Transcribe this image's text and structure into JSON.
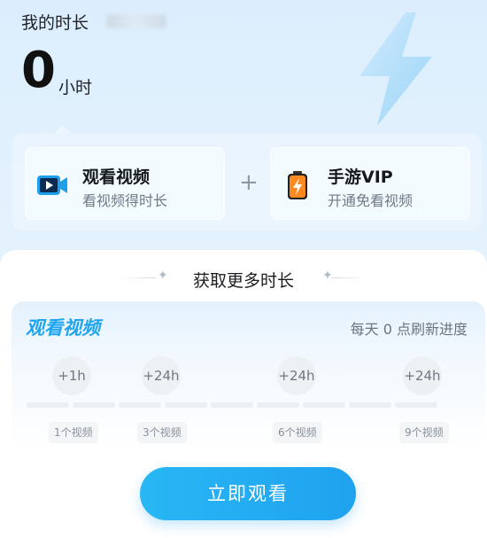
{
  "header": {
    "title": "我的时长",
    "hours_value": "0",
    "hours_unit": "小时"
  },
  "cards": [
    {
      "title": "观看视频",
      "subtitle": "看视频得时长",
      "icon": "video-camera-icon"
    },
    {
      "title": "手游VIP",
      "subtitle": "开通免看视频",
      "icon": "battery-bolt-icon"
    }
  ],
  "plus_symbol": "+",
  "more": {
    "title": "获取更多时长"
  },
  "task": {
    "title": "观看视频",
    "refresh_note": "每天 0 点刷新进度",
    "milestones": [
      {
        "reward": "+1h",
        "videos": "1个视频"
      },
      {
        "reward": "+24h",
        "videos": "3个视频"
      },
      {
        "reward": "+24h",
        "videos": "6个视频"
      },
      {
        "reward": "+24h",
        "videos": "9个视频"
      }
    ]
  },
  "action": {
    "label": "立即观看"
  },
  "colors": {
    "accent": "#1fa4ee",
    "background": "#dceefd"
  }
}
